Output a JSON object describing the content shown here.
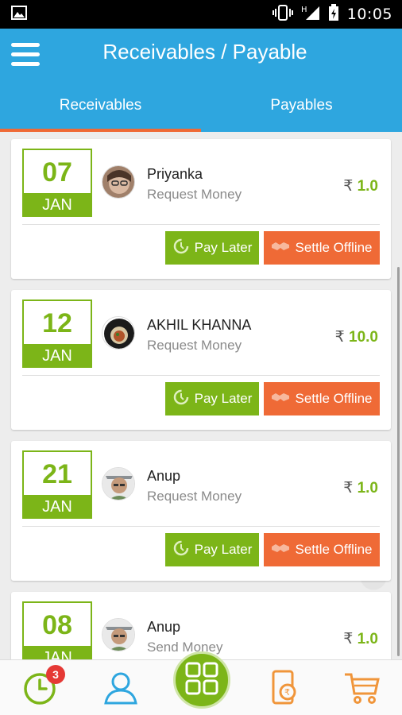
{
  "status_bar": {
    "time": "10:05",
    "signal_label": "H"
  },
  "header": {
    "title": "Receivables / Payable"
  },
  "tabs": [
    {
      "label": "Receivables",
      "active": true
    },
    {
      "label": "Payables",
      "active": false
    }
  ],
  "currency_symbol": "₹",
  "buttons": {
    "pay_later": "Pay Later",
    "settle_offline": "Settle Offline"
  },
  "transactions": [
    {
      "day": "07",
      "month": "JAN",
      "name": "Priyanka",
      "type": "Request Money",
      "amount": "1.0"
    },
    {
      "day": "12",
      "month": "JAN",
      "name": "AKHIL KHANNA",
      "type": "Request Money",
      "amount": "10.0"
    },
    {
      "day": "21",
      "month": "JAN",
      "name": "Anup",
      "type": "Request Money",
      "amount": "1.0"
    },
    {
      "day": "08",
      "month": "JAN",
      "name": "Anup",
      "type": "Send Money",
      "amount": "1.0"
    }
  ],
  "bottom_nav": {
    "badge_count": "3",
    "items": [
      "clock-icon",
      "contacts-icon",
      "grid-icon",
      "bill-icon",
      "cart-icon"
    ]
  },
  "colors": {
    "primary": "#2ea6df",
    "green": "#7cb518",
    "orange": "#ef6a36",
    "icon_orange": "#f0953a"
  }
}
